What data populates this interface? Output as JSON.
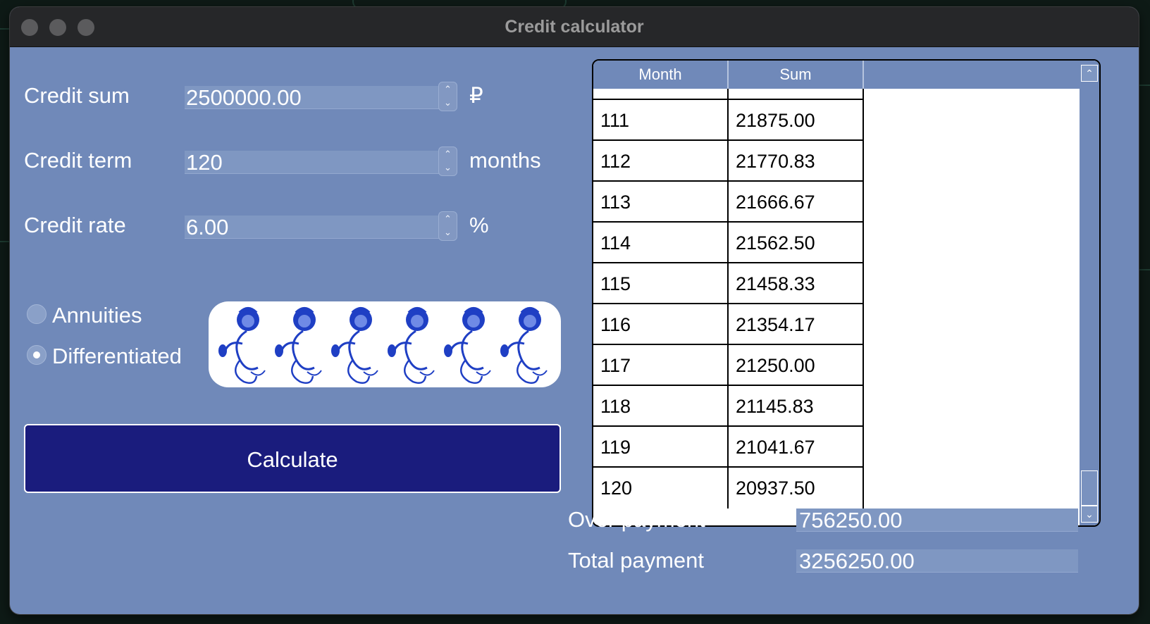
{
  "window": {
    "title": "Credit calculator"
  },
  "form": {
    "credit_sum": {
      "label": "Credit sum",
      "value": "2500000.00",
      "unit": "₽"
    },
    "credit_term": {
      "label": "Credit term",
      "value": "120",
      "unit": "months"
    },
    "credit_rate": {
      "label": "Credit rate",
      "value": "6.00",
      "unit": "%"
    },
    "payment_type": {
      "options": [
        "Annuities",
        "Differentiated"
      ],
      "selected": "Differentiated"
    },
    "calculate_label": "Calculate"
  },
  "table": {
    "headers": [
      "Month",
      "Sum"
    ],
    "rows": [
      [
        "111",
        "21875.00"
      ],
      [
        "112",
        "21770.83"
      ],
      [
        "113",
        "21666.67"
      ],
      [
        "114",
        "21562.50"
      ],
      [
        "115",
        "21458.33"
      ],
      [
        "116",
        "21354.17"
      ],
      [
        "117",
        "21250.00"
      ],
      [
        "118",
        "21145.83"
      ],
      [
        "119",
        "21041.67"
      ],
      [
        "120",
        "20937.50"
      ]
    ]
  },
  "results": {
    "over_payment": {
      "label": "Over payment",
      "value": "756250.00"
    },
    "total_payment": {
      "label": "Total payment",
      "value": "3256250.00"
    }
  },
  "colors": {
    "window_bg": "#7089b9",
    "button_bg": "#1a1c7d",
    "ornament_blue": "#1f3fc4"
  },
  "icons": {
    "spin_up": "chevron-up-icon",
    "spin_down": "chevron-down-icon",
    "scroll_up": "chevron-up-icon",
    "scroll_down": "chevron-down-icon"
  }
}
